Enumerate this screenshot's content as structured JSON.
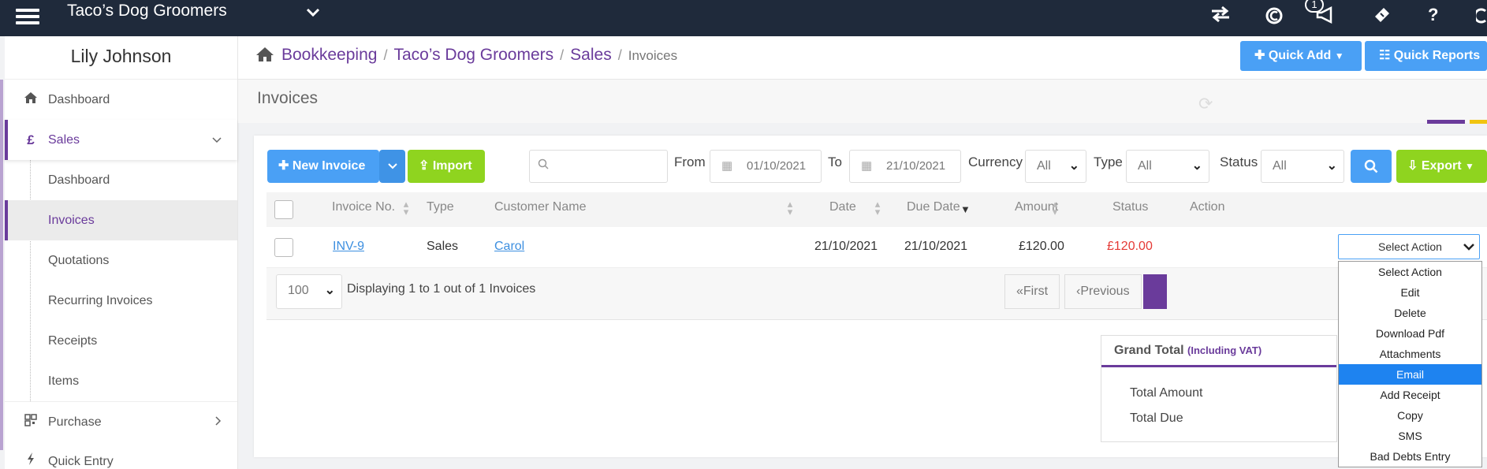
{
  "app": {
    "business_name": "Taco’s Dog Groomers",
    "notification_count": "1"
  },
  "sidebar": {
    "user_name": "Lily Johnson",
    "items": [
      {
        "label": "Dashboard"
      },
      {
        "label": "Sales"
      },
      {
        "label": "Purchase"
      },
      {
        "label": "Quick Entry"
      }
    ],
    "sales_sub": [
      {
        "label": "Dashboard"
      },
      {
        "label": "Invoices"
      },
      {
        "label": "Quotations"
      },
      {
        "label": "Recurring Invoices"
      },
      {
        "label": "Receipts"
      },
      {
        "label": "Items"
      }
    ]
  },
  "breadcrumb": {
    "c1": "Bookkeeping",
    "c2": "Taco’s Dog Groomers",
    "c3": "Sales",
    "current": "Invoices"
  },
  "header_buttons": {
    "quick_add": "Quick Add",
    "quick_reports": "Quick Reports"
  },
  "page": {
    "title": "Invoices"
  },
  "toolbar": {
    "new_invoice": "New Invoice",
    "import": "Import",
    "search_placeholder": "",
    "from_label": "From",
    "from_value": "01/10/2021",
    "to_label": "To",
    "to_value": "21/10/2021",
    "currency_label": "Currency",
    "currency_value": "All",
    "type_label": "Type",
    "type_value": "All",
    "status_label": "Status",
    "status_value": "All",
    "export": "Export"
  },
  "table": {
    "headers": {
      "invoice_no": "Invoice No.",
      "type": "Type",
      "customer": "Customer Name",
      "date": "Date",
      "due_date": "Due Date",
      "amount": "Amount",
      "status": "Status",
      "action": "Action"
    },
    "rows": [
      {
        "invoice_no": "INV-9",
        "type": "Sales",
        "customer": "Carol",
        "date": "21/10/2021",
        "due_date": "21/10/2021",
        "amount": "£120.00",
        "status": "£120.00",
        "action": "Select Action"
      }
    ]
  },
  "pagination": {
    "page_size": "100",
    "summary": "Displaying 1 to 1 out of 1 Invoices",
    "first": "First",
    "previous": "Previous"
  },
  "totals": {
    "title": "Grand Total",
    "subtitle": "(Including VAT)",
    "total_amount": "Total Amount",
    "total_due": "Total Due"
  },
  "action_menu": [
    "Select Action",
    "Edit",
    "Delete",
    "Download Pdf",
    "Attachments",
    "Email",
    "Add Receipt",
    "Copy",
    "SMS",
    "Bad Debts Entry"
  ],
  "colors": {
    "topbar": "#1f2a3b",
    "accent": "#6a3b9b",
    "primary": "#4aa0f5",
    "success": "#8fd41f",
    "danger": "#e53935"
  }
}
